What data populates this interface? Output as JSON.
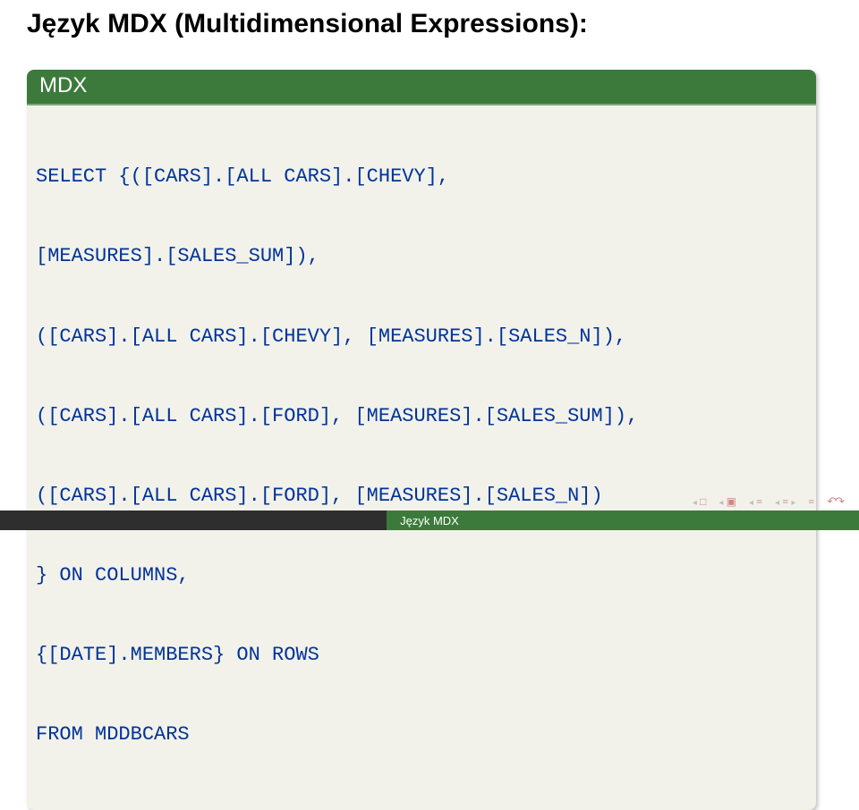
{
  "title": "Język MDX (Multidimensional Expressions):",
  "block": {
    "header": "MDX",
    "code_lines": [
      "SELECT {([CARS].[ALL CARS].[CHEVY],",
      "[MEASURES].[SALES_SUM]),",
      "([CARS].[ALL CARS].[CHEVY], [MEASURES].[SALES_N]),",
      "([CARS].[ALL CARS].[FORD], [MEASURES].[SALES_SUM]),",
      "([CARS].[ALL CARS].[FORD], [MEASURES].[SALES_N])",
      "} ON COLUMNS,",
      "{[DATE].MEMBERS} ON ROWS",
      "FROM MDDBCARS"
    ]
  },
  "footer": "Język MDX"
}
